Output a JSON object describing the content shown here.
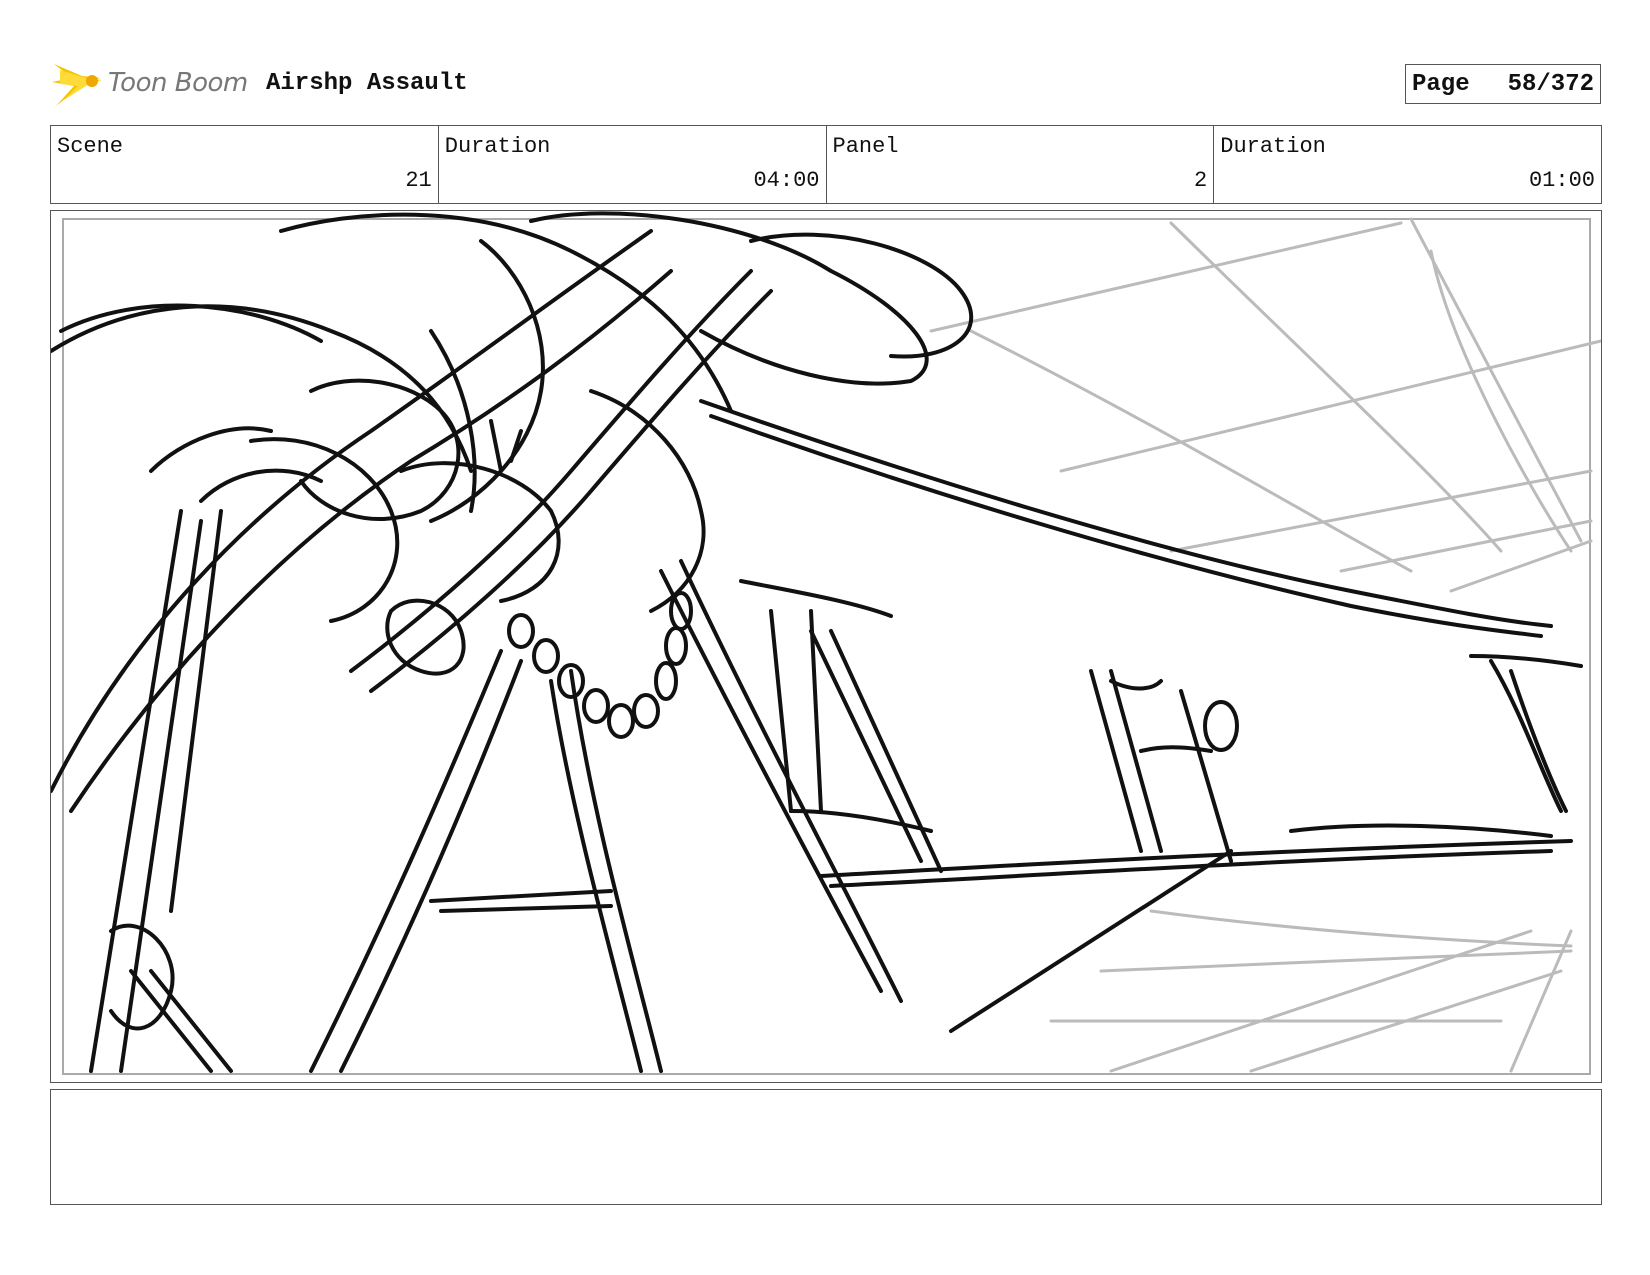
{
  "header": {
    "logo_text": "Toon Boom",
    "project_title": "Airshp Assault",
    "page_label": "Page",
    "page_number": "58/372"
  },
  "info": {
    "scene_label": "Scene",
    "scene_value": "21",
    "scene_duration_label": "Duration",
    "scene_duration_value": "04:00",
    "panel_label": "Panel",
    "panel_value": "2",
    "panel_duration_label": "Duration",
    "panel_duration_value": "01:00"
  },
  "notes": {
    "text": ""
  },
  "colors": {
    "logo_accent": "#f5c400",
    "sketch_ink": "#111111",
    "construction_lines": "#bbbbbb"
  }
}
